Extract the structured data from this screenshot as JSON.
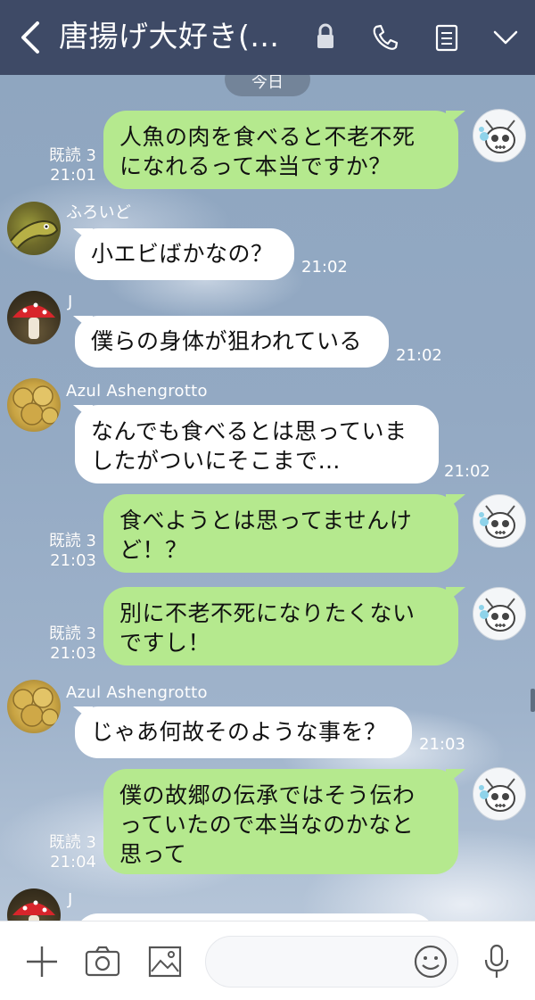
{
  "header": {
    "title": "唐揚げ大好き(...",
    "icons": [
      "back-icon",
      "lock-icon",
      "phone-icon",
      "notes-icon",
      "chevron-down-icon"
    ]
  },
  "chat": {
    "date_label": "今日",
    "messages": [
      {
        "side": "me",
        "text": "人魚の肉を食べると不老不死\nになれるって本当ですか？",
        "read": "既読 3",
        "time": "21:01"
      },
      {
        "side": "them",
        "sender": "ふろいど",
        "avatar": "moray-eel-avatar",
        "text": "小エビばかなの？",
        "time": "21:02"
      },
      {
        "side": "them",
        "sender": "J",
        "avatar": "mushroom-avatar",
        "text": "僕らの身体が狙われている",
        "time": "21:02"
      },
      {
        "side": "them",
        "sender": "Azul Ashengrotto",
        "avatar": "gold-coins-avatar",
        "text": "なんでも食べるとは思っていま\nしたがついにそこまで…",
        "time": "21:02"
      },
      {
        "side": "me",
        "text": "食べようとは思ってませんけ\nど！？",
        "read": "既読 3",
        "time": "21:03"
      },
      {
        "side": "me",
        "text": "別に不老不死になりたくない\nですし！",
        "read": "既読 3",
        "time": "21:03"
      },
      {
        "side": "them",
        "sender": "Azul Ashengrotto",
        "avatar": "gold-coins-avatar",
        "text": "じゃあ何故そのような事を？",
        "time": "21:03"
      },
      {
        "side": "me",
        "text": "僕の故郷の伝承ではそう伝わ\nっていたので本当なのかなと\n思って",
        "read": "既読 3",
        "time": "21:04"
      },
      {
        "side": "them",
        "sender": "J",
        "avatar": "mushroom-avatar",
        "text": "",
        "time": ""
      }
    ]
  },
  "input": {
    "placeholder": "",
    "value": ""
  },
  "bottom_icons": [
    "plus-icon",
    "camera-icon",
    "image-icon",
    "emoji-icon",
    "microphone-icon"
  ],
  "colors": {
    "header": "#3e4a66",
    "my_bubble": "#b5e98e",
    "their_bubble": "#ffffff",
    "bottom_bar": "#ffffff"
  }
}
